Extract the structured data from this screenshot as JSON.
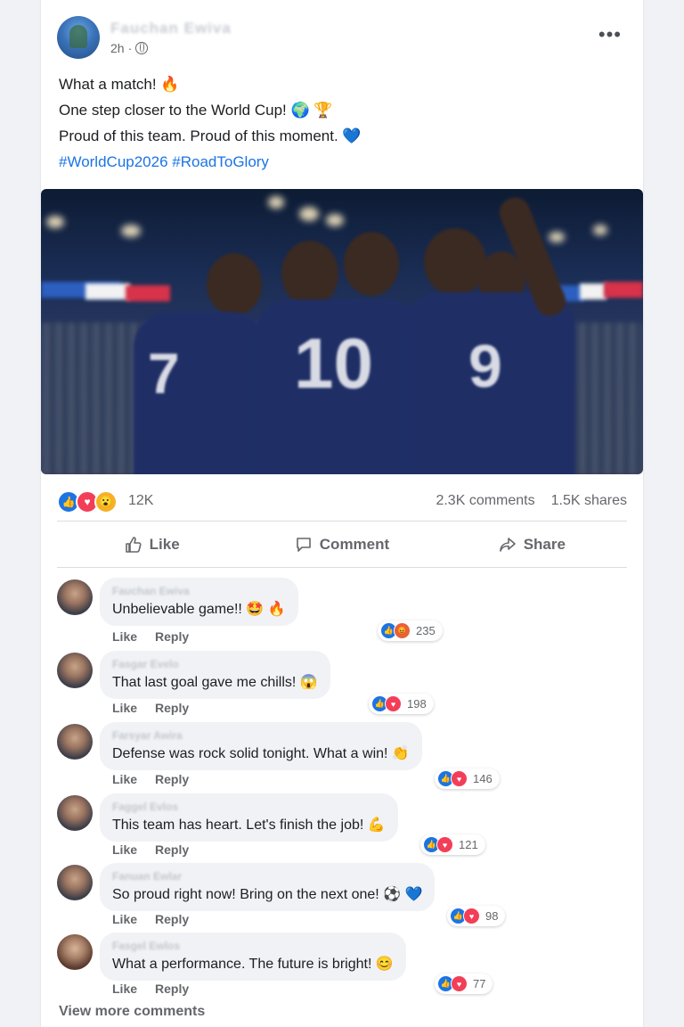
{
  "post": {
    "author_name": "Fauchan Ewiva",
    "time": "2h",
    "more_label": "•••",
    "caption": [
      "What a match! 🔥",
      "One step closer to the World Cup! 🌍 🏆",
      "Proud of this team. Proud of this moment. 💙"
    ],
    "hashtags": "#WorldCup2026 #RoadToGlory",
    "photo": {
      "jersey_numbers": [
        "7",
        "10",
        "9"
      ],
      "colors": {
        "jersey": "#1f2f66",
        "banner_blue": "#2c5fbf",
        "banner_red": "#d8334a",
        "banner_white": "#f2f2f2"
      }
    }
  },
  "stats": {
    "reactions": [
      "like-icon",
      "love-icon",
      "wow-icon"
    ],
    "reaction_count": "12K",
    "comments": "2.3K comments",
    "shares": "1.5K shares"
  },
  "actions": {
    "like": "Like",
    "comment": "Comment",
    "share": "Share"
  },
  "comments": [
    {
      "name": "Fauchan Ewiva",
      "text": "Unbelievable game!! 🤩 🔥",
      "like": "Like",
      "reply": "Reply",
      "reactions": [
        "like-icon",
        "angry-icon"
      ],
      "count": "235"
    },
    {
      "name": "Fasgar Evelo",
      "text": "That last goal gave me chills! 😱",
      "like": "Like",
      "reply": "Reply",
      "reactions": [
        "like-icon",
        "love-icon"
      ],
      "count": "198"
    },
    {
      "name": "Farsyar Awira",
      "text": "Defense was rock solid tonight. What a win! 👏",
      "like": "Like",
      "reply": "Reply",
      "reactions": [
        "like-icon",
        "love-icon"
      ],
      "count": "146"
    },
    {
      "name": "Faggel Evlos",
      "text": "This team has heart. Let's finish the job! 💪",
      "like": "Like",
      "reply": "Reply",
      "reactions": [
        "like-icon",
        "love-icon"
      ],
      "count": "121"
    },
    {
      "name": "Fanuan Ewlar",
      "text": "So proud right now! Bring on the next one! ⚽ 💙",
      "like": "Like",
      "reply": "Reply",
      "reactions": [
        "like-icon",
        "love-icon"
      ],
      "count": "98"
    },
    {
      "name": "Fasgel Ewlos",
      "text": "What a performance. The future is bright! 😊",
      "like": "Like",
      "reply": "Reply",
      "reactions": [
        "like-icon",
        "love-icon"
      ],
      "count": "77"
    }
  ],
  "view_more": "View more comments"
}
